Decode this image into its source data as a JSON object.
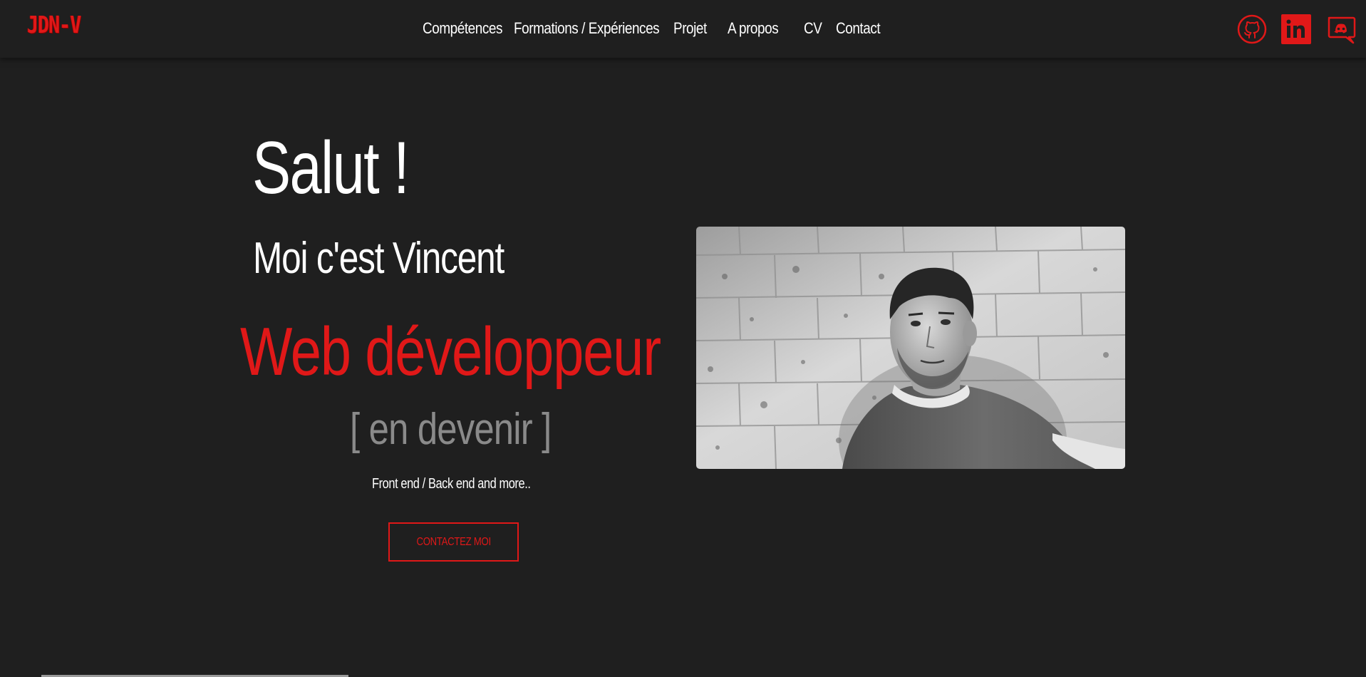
{
  "brand": {
    "logo": "JDN-V",
    "accent_color": "#e01818",
    "background_color": "#1f1f1f"
  },
  "nav": {
    "items": [
      {
        "label": "Compétences"
      },
      {
        "label": "Formations / Expériences"
      },
      {
        "label": "Projet"
      },
      {
        "label": "A propos"
      },
      {
        "label": "CV"
      },
      {
        "label": "Contact"
      }
    ]
  },
  "social": {
    "items": [
      {
        "icon": "github-icon"
      },
      {
        "icon": "linkedin-icon"
      },
      {
        "icon": "discord-icon"
      }
    ]
  },
  "hero": {
    "title": "Salut !",
    "subtitle": "Moi c'est Vincent",
    "role": "Web développeur",
    "becoming": "[ en devenir ]",
    "tagline": "Front end / Back end and more..",
    "cta": "CONTACTEZ MOI"
  },
  "photo": {
    "alt": "portrait-photo"
  }
}
